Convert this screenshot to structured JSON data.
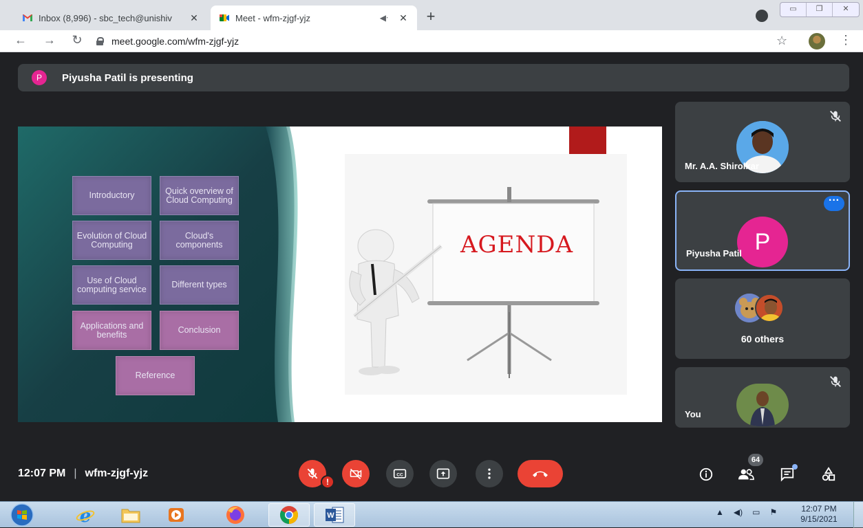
{
  "browser": {
    "tabs": [
      {
        "title": "Inbox (8,996) - sbc_tech@unishiv",
        "icon": "gmail-icon",
        "active": false
      },
      {
        "title": "Meet - wfm-zjgf-yjz",
        "icon": "meet-icon",
        "active": true
      }
    ],
    "close_glyph": "✕",
    "new_tab_glyph": "+",
    "url": "meet.google.com/wfm-zjgf-yjz"
  },
  "meet": {
    "presenter_initial": "P",
    "presenting_text": "Piyusha Patil is presenting",
    "slide": {
      "items": [
        "Introductory",
        "Quick overview of Cloud Computing",
        "Evolution of Cloud Computing",
        "Cloud's components",
        "Use of Cloud computing service",
        "Different types",
        "Applications and benefits",
        "Conclusion",
        "Reference"
      ],
      "board_text": "AGENDA"
    },
    "participants": [
      {
        "name": "Mr. A.A. Shirolkar",
        "muted": true
      },
      {
        "name": "Piyusha Patil",
        "initial": "P",
        "speaking_tile": true
      },
      {
        "others_label": "60 others"
      },
      {
        "name": "You",
        "muted": true
      }
    ],
    "time": "12:07 PM",
    "separator": "|",
    "meeting_code": "wfm-zjgf-yjz",
    "people_count": "64",
    "accent": {
      "red": "#ea4335",
      "blue": "#1a73e8",
      "pink": "#e52592"
    }
  },
  "taskbar": {
    "apps": [
      "start-orb",
      "internet-explorer",
      "file-explorer",
      "media-player",
      "firefox",
      "chrome",
      "word"
    ],
    "clock_time": "12:07 PM",
    "clock_date": "9/15/2021"
  }
}
